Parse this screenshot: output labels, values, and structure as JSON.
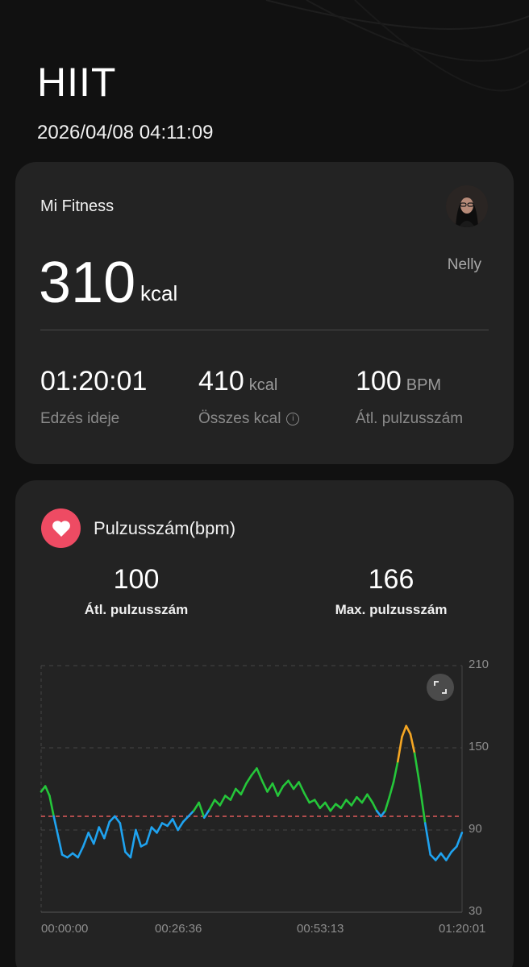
{
  "header": {
    "title": "HIIT",
    "datetime": "2026/04/08 04:11:09"
  },
  "summary": {
    "app_name": "Mi Fitness",
    "user_name": "Nelly",
    "active_kcal": "310",
    "active_kcal_unit": "kcal",
    "stats": [
      {
        "value": "01:20:01",
        "unit": "",
        "label": "Edzés ideje"
      },
      {
        "value": "410",
        "unit": "kcal",
        "label": "Összes kcal",
        "info_icon": "info-icon"
      },
      {
        "value": "100",
        "unit": "BPM",
        "label": "Átl. pulzusszám"
      }
    ]
  },
  "heart_rate": {
    "icon": "heart-icon",
    "title": "Pulzusszám(bpm)",
    "avg_value": "100",
    "avg_label": "Átl. pulzusszám",
    "max_value": "166",
    "max_label": "Max. pulzusszám"
  },
  "colors": {
    "accent_heart": "#ee4b63",
    "zone_blue": "#1fa3f0",
    "zone_green": "#25c63a",
    "zone_orange": "#f5a623",
    "avg_line": "#e05a5a"
  },
  "chart_data": {
    "type": "line",
    "y_ticks": [
      "210",
      "150",
      "90",
      "30"
    ],
    "x_ticks": [
      "00:00:00",
      "00:26:36",
      "00:53:13",
      "01:20:01"
    ],
    "ylim": [
      30,
      210
    ],
    "xlim_minutes": [
      0,
      80.02
    ],
    "average_line": 100,
    "zone_thresholds": {
      "green_above": 102,
      "orange_above": 139
    },
    "series": [
      {
        "x_minutes": [
          0,
          0.8,
          1.6,
          2.4,
          3.2,
          4,
          5,
          6,
          7,
          8,
          9,
          10,
          11,
          12,
          13,
          14,
          15,
          16,
          17,
          18,
          19,
          20,
          21,
          22,
          23,
          24,
          25,
          26,
          27,
          28,
          29,
          30,
          31,
          32,
          33,
          34,
          35,
          36,
          37,
          38,
          39,
          40,
          41,
          42,
          43,
          44,
          45,
          46,
          47,
          48,
          49,
          50,
          51,
          52,
          53,
          54,
          55,
          56,
          57,
          58,
          59,
          60,
          61,
          62,
          63,
          63.8,
          64.6,
          65.4,
          66.2,
          67,
          67.8,
          68.6,
          69.4,
          70.2,
          71,
          72,
          73,
          74,
          75,
          76,
          77,
          78,
          79,
          80
        ],
        "values": [
          118,
          122,
          115,
          100,
          86,
          72,
          70,
          73,
          70,
          78,
          88,
          80,
          92,
          84,
          96,
          100,
          95,
          74,
          70,
          90,
          78,
          80,
          92,
          88,
          95,
          93,
          98,
          90,
          96,
          100,
          104,
          110,
          99,
          105,
          112,
          108,
          115,
          112,
          120,
          116,
          124,
          130,
          135,
          126,
          118,
          124,
          115,
          122,
          126,
          120,
          125,
          117,
          110,
          112,
          106,
          110,
          104,
          109,
          106,
          112,
          108,
          114,
          110,
          116,
          110,
          104,
          100,
          104,
          114,
          125,
          140,
          158,
          166,
          160,
          146,
          122,
          95,
          72,
          68,
          73,
          68,
          74,
          78,
          88
        ]
      }
    ]
  }
}
